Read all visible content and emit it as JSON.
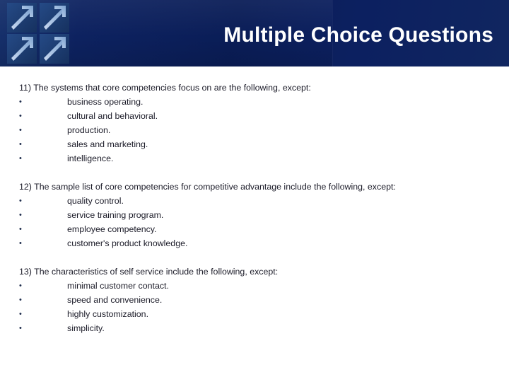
{
  "banner": {
    "title": "Multiple Choice Questions",
    "logo_name": "four-arrows-logo",
    "bg_color": "#0b2060",
    "title_color": "#ffffff"
  },
  "content": {
    "text_color": "#1b1b28",
    "bullet_glyph": "•",
    "questions": [
      {
        "number": "11)",
        "stem": "11) The systems that core competencies focus on are the following, except:",
        "choices": [
          "business operating.",
          "cultural and behavioral.",
          "production.",
          "sales and marketing.",
          "intelligence."
        ]
      },
      {
        "number": "12)",
        "stem": "12) The sample list of core competencies for competitive advantage include the following, except:",
        "choices": [
          "quality control.",
          "service training program.",
          "employee competency.",
          "customer's product knowledge."
        ]
      },
      {
        "number": "13)",
        "stem": "13) The characteristics of self service include the following, except:",
        "choices": [
          "minimal customer contact.",
          "speed and convenience.",
          "highly customization.",
          "simplicity."
        ]
      }
    ]
  }
}
